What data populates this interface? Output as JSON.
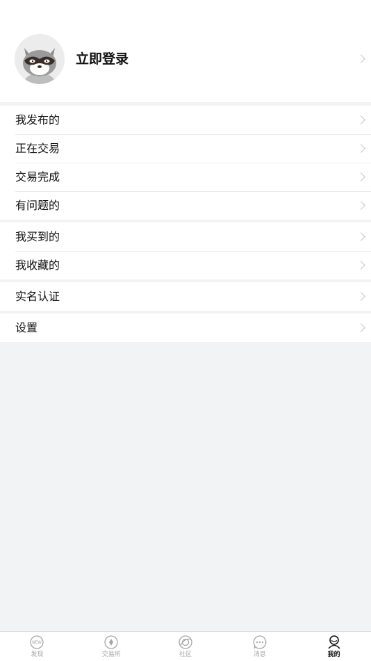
{
  "header": {
    "login_label": "立即登录"
  },
  "groups": [
    {
      "items": [
        {
          "label": "我发布的"
        },
        {
          "label": "正在交易"
        },
        {
          "label": "交易完成"
        },
        {
          "label": "有问题的"
        }
      ]
    },
    {
      "items": [
        {
          "label": "我买到的"
        },
        {
          "label": "我收藏的"
        }
      ]
    },
    {
      "items": [
        {
          "label": "实名认证"
        }
      ]
    },
    {
      "items": [
        {
          "label": "设置"
        }
      ]
    }
  ],
  "tabbar": {
    "active_index": 4,
    "tabs": [
      {
        "label": "发现",
        "icon": "new-badge-icon",
        "icon_text": "NEW"
      },
      {
        "label": "交易所",
        "icon": "exchange-icon"
      },
      {
        "label": "社区",
        "icon": "community-icon"
      },
      {
        "label": "消息",
        "icon": "message-icon"
      },
      {
        "label": "我的",
        "icon": "user-icon"
      }
    ]
  },
  "colors": {
    "background": "#f2f3f5",
    "surface": "#ffffff",
    "text": "#111111",
    "muted": "#a6a6a6",
    "chevron": "#c6c6c6"
  }
}
